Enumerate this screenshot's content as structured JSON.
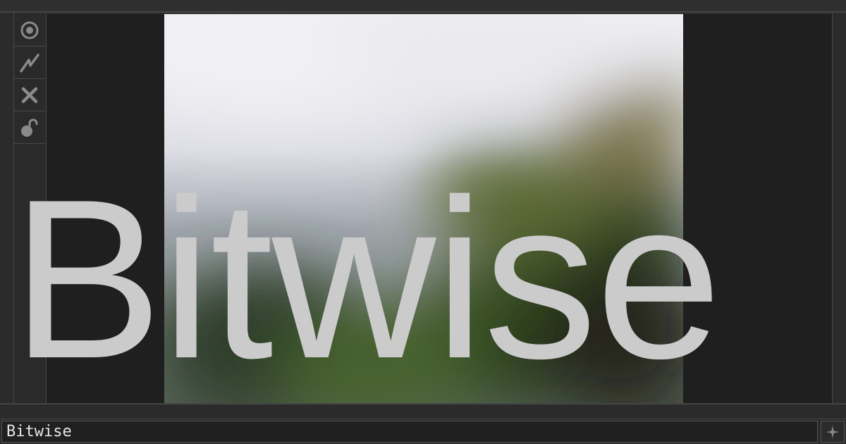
{
  "app": {
    "title": "Bitwise"
  },
  "toolbar": {
    "items": [
      {
        "icon": "eye-icon"
      },
      {
        "icon": "lightning-icon"
      },
      {
        "icon": "close-icon"
      },
      {
        "icon": "unlock-icon"
      }
    ]
  },
  "command_bar": {
    "value": "Bitwise",
    "add_icon": "plus-icon"
  },
  "colors": {
    "panel": "#2b2b2b",
    "viewport": "#1f1f1f",
    "title_text": "#cbcbcb",
    "icon": "#8a8a8a"
  }
}
